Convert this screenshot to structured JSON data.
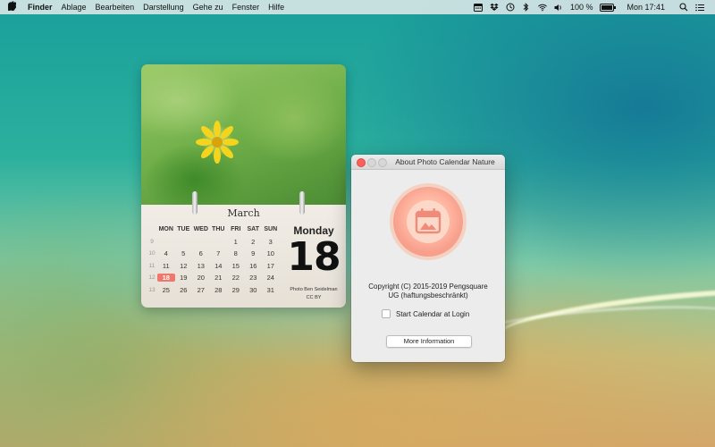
{
  "menubar": {
    "app_name": "Finder",
    "items": [
      "Ablage",
      "Bearbeiten",
      "Darstellung",
      "Gehe zu",
      "Fenster",
      "Hilfe"
    ],
    "battery_percent": "100 %",
    "clock": "Mon 17:41",
    "battery_level": 1.0
  },
  "calendar": {
    "month": "March",
    "weekday_headers": [
      "MON",
      "TUE",
      "WED",
      "THU",
      "FRI",
      "SAT",
      "SUN"
    ],
    "weeks": [
      {
        "week": "9",
        "days": [
          "",
          "",
          "",
          "",
          "1",
          "2",
          "3"
        ]
      },
      {
        "week": "10",
        "days": [
          "4",
          "5",
          "6",
          "7",
          "8",
          "9",
          "10"
        ]
      },
      {
        "week": "11",
        "days": [
          "11",
          "12",
          "13",
          "14",
          "15",
          "16",
          "17"
        ]
      },
      {
        "week": "12",
        "days": [
          "18",
          "19",
          "20",
          "21",
          "22",
          "23",
          "24"
        ]
      },
      {
        "week": "13",
        "days": [
          "25",
          "26",
          "27",
          "28",
          "29",
          "30",
          "31"
        ]
      }
    ],
    "today": "18",
    "day_name": "Monday",
    "day_number": "18",
    "photo_credit": "Photo Ben Seidelman",
    "license": "CC BY",
    "accent_color": "#f0776b"
  },
  "about_window": {
    "title": "About Photo Calendar Nature",
    "copyright_line1": "Copyright (C) 2015-2019 Pengsquare",
    "copyright_line2": "UG (haftungsbeschränkt)",
    "login_label": "Start Calendar at Login",
    "login_checked": false,
    "more_info_label": "More Information"
  }
}
